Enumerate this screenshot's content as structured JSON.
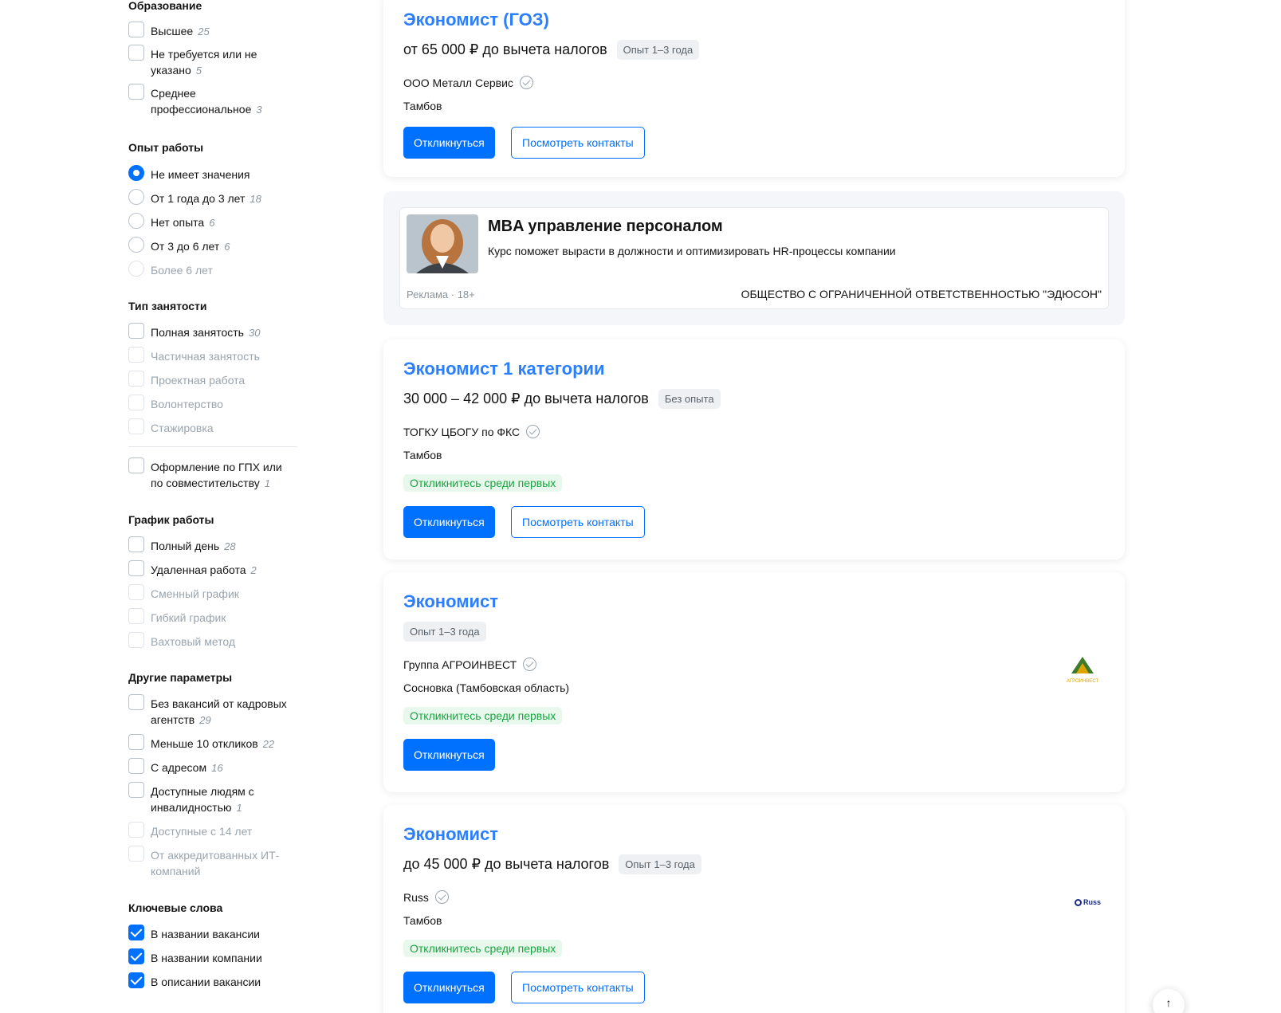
{
  "filters": {
    "education": {
      "title": "Образование",
      "options": [
        {
          "label": "Высшее",
          "count": "25"
        },
        {
          "label": "Не требуется или не указано",
          "count": "5"
        },
        {
          "label": "Среднее профессиональное",
          "count": "3"
        }
      ]
    },
    "experience": {
      "title": "Опыт работы",
      "options": [
        {
          "label": "Не имеет значения",
          "count": ""
        },
        {
          "label": "От 1 года до 3 лет",
          "count": "18"
        },
        {
          "label": "Нет опыта",
          "count": "6"
        },
        {
          "label": "От 3 до 6 лет",
          "count": "6"
        },
        {
          "label": "Более 6 лет",
          "count": ""
        }
      ]
    },
    "employment": {
      "title": "Тип занятости",
      "options": [
        {
          "label": "Полная занятость",
          "count": "30"
        },
        {
          "label": "Частичная занятость",
          "count": ""
        },
        {
          "label": "Проектная работа",
          "count": ""
        },
        {
          "label": "Волонтерство",
          "count": ""
        },
        {
          "label": "Стажировка",
          "count": ""
        },
        {
          "label": "Оформление по ГПХ или по совместительству",
          "count": "1"
        }
      ]
    },
    "schedule": {
      "title": "График работы",
      "options": [
        {
          "label": "Полный день",
          "count": "28"
        },
        {
          "label": "Удаленная работа",
          "count": "2"
        },
        {
          "label": "Сменный график",
          "count": ""
        },
        {
          "label": "Гибкий график",
          "count": ""
        },
        {
          "label": "Вахтовый метод",
          "count": ""
        }
      ]
    },
    "other": {
      "title": "Другие параметры",
      "options": [
        {
          "label": "Без вакансий от кадровых агентств",
          "count": "29"
        },
        {
          "label": "Меньше 10 откликов",
          "count": "22"
        },
        {
          "label": "С адресом",
          "count": "16"
        },
        {
          "label": "Доступные людям с инвалидностью",
          "count": "1"
        },
        {
          "label": "Доступные с 14 лет",
          "count": ""
        },
        {
          "label": "От аккредитованных ИТ-компаний",
          "count": ""
        }
      ]
    },
    "keywords": {
      "title": "Ключевые слова",
      "options": [
        {
          "label": "В названии вакансии",
          "count": ""
        },
        {
          "label": "В названии компании",
          "count": ""
        },
        {
          "label": "В описании вакансии",
          "count": ""
        }
      ]
    }
  },
  "vacancies": [
    {
      "title": "Экономист (ГОЗ)",
      "salary": "от 65 000 ₽ до вычета налогов",
      "experience": "Опыт 1–3 года",
      "company": "ООО Металл Сервис",
      "city": "Тамбов",
      "badge": "",
      "apply": "Откликнуться",
      "contacts": "Посмотреть контакты"
    },
    {
      "title": "Экономист 1 категории",
      "salary": "30 000 – 42 000 ₽ до вычета налогов",
      "experience": "Без опыта",
      "company": "ТОГКУ ЦБОГУ по ФКС",
      "city": "Тамбов",
      "badge": "Откликнитесь среди первых",
      "apply": "Откликнуться",
      "contacts": "Посмотреть контакты"
    },
    {
      "title": "Экономист",
      "salary": "",
      "experience": "Опыт 1–3 года",
      "company": "Группа АГРОИНВЕСТ",
      "city": "Сосновка (Тамбовская область)",
      "badge": "Откликнитесь среди первых",
      "apply": "Откликнуться",
      "contacts": "",
      "logo_text": "АГРОИНВЕСТ",
      "logo_color": "#e0a400"
    },
    {
      "title": "Экономист",
      "salary": "до 45 000 ₽ до вычета налогов",
      "experience": "Опыт 1–3 года",
      "company": "Russ",
      "city": "Тамбов",
      "badge": "Откликнитесь среди первых",
      "apply": "Откликнуться",
      "contacts": "Посмотреть контакты",
      "logo_text": "Russ",
      "logo_color": "#1a2a8a"
    }
  ],
  "ad": {
    "title": "MBA управление персоналом",
    "description": "Курс поможет вырасти в должности и оптимизировать HR-процессы компании",
    "label": "Реклама · 18+",
    "advertiser": "ОБЩЕСТВО С ОГРАНИЧЕННОЙ ОТВЕТСТВЕННОСТЬЮ \"ЭДЮСОН\""
  },
  "icons": {
    "scroll_top": "arrow-up-icon",
    "verified": "verified-check-icon"
  },
  "colors": {
    "accent": "#0070ff",
    "title_link": "#2b7fff",
    "success": "#1aa341"
  }
}
